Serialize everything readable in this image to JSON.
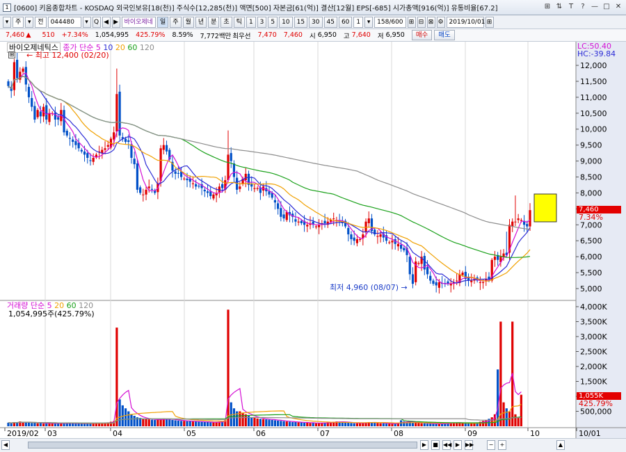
{
  "window": {
    "icon": "1",
    "title": "[0600] 키움종합차트 - KOSDAQ 외국인보유[18(천)] 주식수[12,285(천)] 액면[500] 자본금[61(억)] 결산[12월] EPS[-685] 시가총액[916(억)] 유통비율[67.2]",
    "controls": [
      "⊞",
      "⇅",
      "T",
      "?",
      "—",
      "□",
      "✕"
    ]
  },
  "toolbar": {
    "items": [
      "▾",
      "주",
      "▾",
      "전",
      "044480",
      "▾",
      "Q",
      "◀",
      "▶",
      "바이오제네",
      "일",
      "주",
      "월",
      "년",
      "분",
      "초",
      "틱",
      "1",
      "3",
      "5",
      "10",
      "15",
      "30",
      "45",
      "60",
      "1",
      "▾",
      "158/600",
      "⊞",
      "⊟",
      "⊠",
      "⚙",
      "2019/10/01",
      "⊞"
    ]
  },
  "quote": {
    "price": "7,460",
    "change_arrow": "▲",
    "change": "510",
    "change_pct": "+7.34%",
    "volume": "1,054,995",
    "volume_pct": "425.79%",
    "turnover": "8.59%",
    "amount": "7,772백만",
    "priority_label": "최우선",
    "bid1": "7,470",
    "bid2": "7,460",
    "open_label": "시",
    "open": "6,950",
    "high_label": "고",
    "high": "7,640",
    "low_label": "저",
    "low": "6,950",
    "buy_btn": "매수",
    "sell_btn": "매도"
  },
  "legend": {
    "stock_name": "바이오제네틱스",
    "price_series": "종가 단순 5",
    "ma10": "10",
    "ma20": "20",
    "ma60": "60",
    "ma120": "120",
    "volume_series": "거래량 단순 5",
    "vma20": "20",
    "vma60": "60",
    "vma120": "120",
    "volume_value": "1,054,995주(425.79%)"
  },
  "annotations": {
    "high": "최고 12,400 (02/20)",
    "low": "최저 4,960 (08/07)",
    "lc": "LC:50.40",
    "hc": "HC:-39.84",
    "last_price": "7,460",
    "last_pct": "7.34%",
    "last_volume": "1,055K",
    "last_volume_pct": "425.79%"
  },
  "colors": {
    "up": "#e00000",
    "down": "#0050c8",
    "ma5": "#d40fd4",
    "ma10": "#2b2bd6",
    "ma20": "#f0a000",
    "ma60": "#18a018",
    "ma120": "#8c8c8c",
    "highlight_box": "#ffff00"
  },
  "chart_data": {
    "type": "candlestick",
    "price_axis": [
      "12,000",
      "11,500",
      "11,000",
      "10,500",
      "10,000",
      "9,500",
      "9,000",
      "8,500",
      "8,000",
      "7,500",
      "7,000",
      "6,500",
      "6,000",
      "5,500",
      "5,000"
    ],
    "volume_axis": [
      "4,000K",
      "3,500K",
      "3,000K",
      "2,500K",
      "2,000K",
      "1,500K",
      "1,000K",
      "500,000"
    ],
    "x_labels": [
      "2019/02",
      "03",
      "04",
      "05",
      "06",
      "07",
      "08",
      "09",
      "10",
      "10/01"
    ],
    "x_label_pos": [
      10,
      68,
      162,
      268,
      368,
      460,
      566,
      672,
      762,
      832
    ],
    "closes": [
      11350,
      11200,
      12100,
      11600,
      11800,
      11900,
      11400,
      11000,
      10700,
      10300,
      10600,
      10400,
      10700,
      10300,
      10500,
      10500,
      10300,
      10300,
      10600,
      9900,
      9800,
      9700,
      9600,
      9500,
      9400,
      9300,
      9200,
      9100,
      9000,
      9100,
      9200,
      9300,
      9350,
      9400,
      9500,
      9700,
      9900,
      11100,
      9800,
      9700,
      9600,
      9600,
      9100,
      8900,
      8100,
      8000,
      7950,
      8100,
      8200,
      8100,
      8000,
      8300,
      9400,
      9500,
      9300,
      9050,
      8700,
      8600,
      8600,
      8500,
      8450,
      8400,
      8350,
      8300,
      8200,
      8200,
      8150,
      8050,
      8000,
      7900,
      7950,
      8000,
      8200,
      8150,
      8400,
      9200,
      9000,
      8500,
      8100,
      8200,
      8450,
      8600,
      8250,
      8200,
      8150,
      8150,
      8000,
      8200,
      8050,
      7950,
      7850,
      7700,
      7500,
      7250,
      7200,
      7400,
      7300,
      7250,
      7100,
      7100,
      7050,
      7000,
      7000,
      7050,
      7000,
      6950,
      7000,
      7050,
      7050,
      7100,
      7150,
      7200,
      7150,
      7100,
      7050,
      6950,
      6700,
      6550,
      6500,
      6550,
      6550,
      6700,
      7100,
      7200,
      6800,
      6700,
      6650,
      6700,
      6600,
      6500,
      6450,
      6500,
      6400,
      6400,
      6250,
      6200,
      6050,
      5450,
      5150,
      5850,
      5800,
      6000,
      5600,
      5450,
      5250,
      5150,
      5100,
      5200,
      5150,
      5150,
      5150,
      5150,
      5200,
      5250,
      5450,
      5500,
      5300,
      5250,
      5250,
      5300,
      5250,
      5200,
      5200,
      5300,
      5300,
      5900,
      6000,
      5900,
      6000,
      6100,
      6050,
      7000,
      7100,
      7100,
      7200,
      7150,
      7000,
      6950,
      7460
    ],
    "volumes": [
      120,
      110,
      140,
      130,
      160,
      120,
      130,
      140,
      110,
      120,
      100,
      110,
      90,
      95,
      100,
      100,
      95,
      90,
      110,
      90,
      100,
      110,
      95,
      90,
      100,
      90,
      95,
      100,
      90,
      100,
      95,
      100,
      110,
      120,
      130,
      150,
      170,
      3300,
      900,
      700,
      600,
      500,
      400,
      350,
      300,
      280,
      250,
      240,
      230,
      220,
      210,
      220,
      240,
      260,
      240,
      220,
      210,
      200,
      190,
      180,
      180,
      170,
      170,
      160,
      160,
      150,
      150,
      140,
      140,
      130,
      130,
      140,
      150,
      160,
      200,
      3900,
      800,
      600,
      500,
      500,
      450,
      400,
      350,
      300,
      280,
      260,
      250,
      240,
      230,
      220,
      210,
      200,
      190,
      180,
      170,
      160,
      150,
      140,
      140,
      130,
      130,
      120,
      120,
      110,
      110,
      100,
      100,
      110,
      120,
      130,
      140,
      150,
      160,
      150,
      140,
      130,
      120,
      110,
      100,
      100,
      110,
      120,
      130,
      140,
      130,
      120,
      110,
      100,
      100,
      90,
      90,
      80,
      80,
      120,
      200,
      160,
      150,
      140,
      130,
      120,
      110,
      100,
      100,
      90,
      90,
      80,
      80,
      80,
      90,
      100,
      110,
      120,
      130,
      120,
      110,
      100,
      100,
      100,
      110,
      120,
      130,
      150,
      180,
      200,
      250,
      300,
      400,
      1900,
      3500,
      800,
      600,
      500,
      3500,
      400,
      300,
      1055
    ]
  }
}
